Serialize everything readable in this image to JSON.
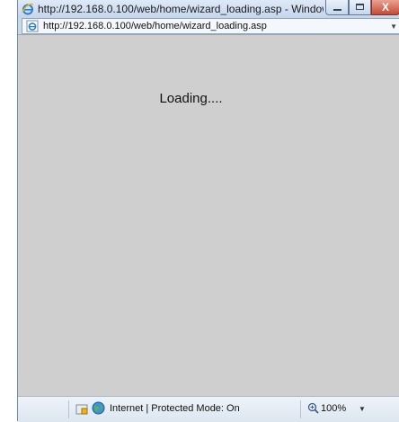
{
  "window": {
    "title": "http://192.168.0.100/web/home/wizard_loading.asp - Window...",
    "close_glyph": "X"
  },
  "address": {
    "url": "http://192.168.0.100/web/home/wizard_loading.asp"
  },
  "content": {
    "loading_text": "Loading...."
  },
  "status": {
    "zone_text": "Internet | Protected Mode: On",
    "zoom_level": "100%"
  },
  "colors": {
    "content_bg": "#cfcfcf",
    "chrome_blue": "#c9d9ea"
  },
  "icons": [
    "ie-logo-icon",
    "ie-page-icon",
    "security-zone-icon",
    "globe-icon",
    "zoom-icon",
    "dropdown-arrow-icon"
  ]
}
